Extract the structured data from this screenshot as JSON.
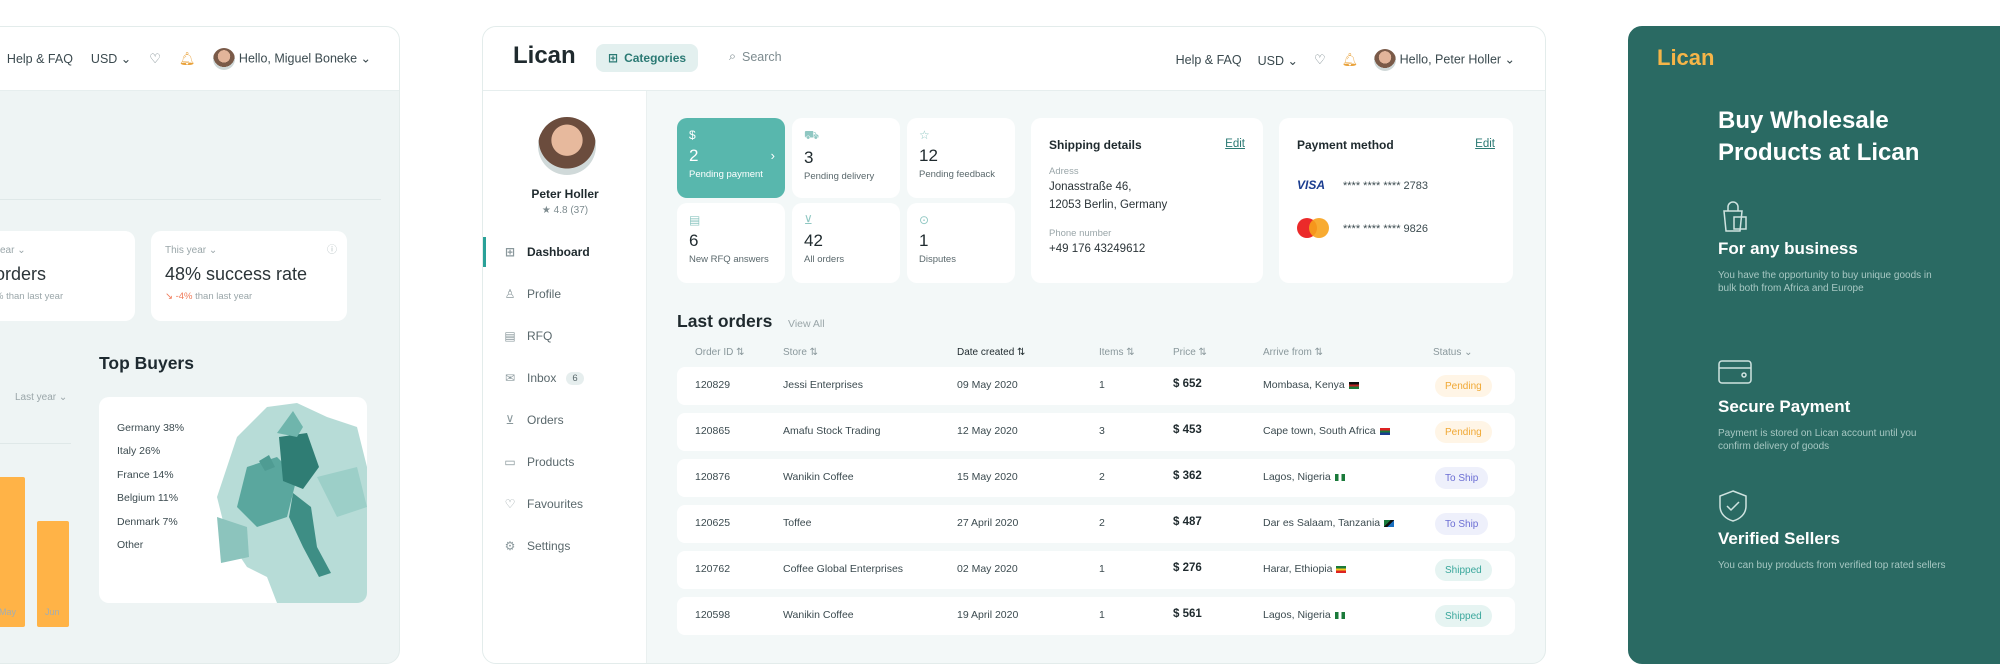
{
  "left_panel": {
    "header": {
      "help": "Help & FAQ",
      "currency": "USD ⌄",
      "greeting": "Hello, Miguel Boneke ⌄"
    },
    "stat1": {
      "period": "year ⌄",
      "value": "orders",
      "note": "% than last year"
    },
    "stat2": {
      "period": "This year ⌄",
      "value": "48% success rate",
      "change": "↘ -4%",
      "note": " than last year"
    },
    "top_buyers_title": "Top Buyers",
    "last_year_select": "Last year ⌄",
    "buyers": [
      "Germany 38%",
      "Italy 26%",
      "France 14%",
      "Belgium 11%",
      "Denmark 7%",
      "Other"
    ],
    "months": [
      "May",
      "Jun"
    ],
    "bars": [
      0.72,
      0.46
    ]
  },
  "main": {
    "logo": "Lican",
    "categories": "Categories",
    "search_placeholder": "Search",
    "help": "Help & FAQ",
    "currency": "USD ⌄",
    "greeting": "Hello, Peter Holler ⌄",
    "profile": {
      "name": "Peter Holler",
      "rating": "★ 4.8 (37)"
    },
    "nav": [
      {
        "label": "Dashboard",
        "icon": "grid-icon"
      },
      {
        "label": "Profile",
        "icon": "user-icon"
      },
      {
        "label": "RFQ",
        "icon": "rfq-icon"
      },
      {
        "label": "Inbox",
        "icon": "mail-icon",
        "badge": "6"
      },
      {
        "label": "Orders",
        "icon": "cart-icon"
      },
      {
        "label": "Products",
        "icon": "box-icon"
      },
      {
        "label": "Favourites",
        "icon": "heart-icon"
      },
      {
        "label": "Settings",
        "icon": "gear-icon"
      }
    ],
    "tiles": [
      {
        "value": "2",
        "label": "Pending payment"
      },
      {
        "value": "3",
        "label": "Pending delivery"
      },
      {
        "value": "12",
        "label": "Pending feedback"
      },
      {
        "value": "6",
        "label": "New RFQ answers"
      },
      {
        "value": "42",
        "label": "All orders"
      },
      {
        "value": "1",
        "label": "Disputes"
      }
    ],
    "shipping": {
      "title": "Shipping details",
      "edit": "Edit",
      "address_label": "Adress",
      "address_line1": "Jonasstraße 46,",
      "address_line2": "12053 Berlin, Germany",
      "phone_label": "Phone number",
      "phone": "+49 176 43249612"
    },
    "payment": {
      "title": "Payment method",
      "edit": "Edit",
      "visa_brand": "VISA",
      "visa_number": "**** **** **** 2783",
      "mc_number": "**** **** **** 9826"
    },
    "orders_title": "Last orders",
    "view_all": "View All",
    "columns": [
      "Order ID ⇅",
      "Store ⇅",
      "Date created ⇅",
      "Items ⇅",
      "Price ⇅",
      "Arrive from ⇅",
      "Status ⌄"
    ],
    "orders": [
      {
        "id": "120829",
        "store": "Jessi Enterprises",
        "date": "09 May 2020",
        "items": "1",
        "price": "$ 652",
        "from": "Mombasa, Kenya",
        "status": "Pending"
      },
      {
        "id": "120865",
        "store": "Amafu Stock Trading",
        "date": "12 May 2020",
        "items": "3",
        "price": "$ 453",
        "from": "Cape town, South Africa",
        "status": "Pending"
      },
      {
        "id": "120876",
        "store": "Wanikin Coffee",
        "date": "15 May 2020",
        "items": "2",
        "price": "$ 362",
        "from": "Lagos, Nigeria",
        "status": "To Ship"
      },
      {
        "id": "120625",
        "store": "Toffee",
        "date": "27 April 2020",
        "items": "2",
        "price": "$ 487",
        "from": "Dar es Salaam, Tanzania",
        "status": "To Ship"
      },
      {
        "id": "120762",
        "store": "Coffee Global Enterprises",
        "date": "02 May 2020",
        "items": "1",
        "price": "$ 276",
        "from": "Harar, Ethiopia",
        "status": "Shipped"
      },
      {
        "id": "120598",
        "store": "Wanikin Coffee",
        "date": "19 April 2020",
        "items": "1",
        "price": "$ 561",
        "from": "Lagos, Nigeria",
        "status": "Shipped"
      }
    ]
  },
  "right_panel": {
    "logo": "Lican",
    "title": "Buy Wholesale Products at Lican",
    "features": [
      {
        "icon": "shopping-bag-icon",
        "title": "For any business",
        "desc": "You have the opportunity to buy unique goods in bulk both from Africa and Europe"
      },
      {
        "icon": "wallet-icon",
        "title": "Secure Payment",
        "desc": "Payment is stored on Lican account until you confirm delivery of goods"
      },
      {
        "icon": "shield-check-icon",
        "title": "Verified Sellers",
        "desc": "You can buy products from verified top rated sellers"
      }
    ]
  },
  "colors": {
    "accent": "#58b7ad",
    "brand_dark": "#2a6a63",
    "logo_orange": "#f6b548",
    "bar": "#ffb347"
  }
}
